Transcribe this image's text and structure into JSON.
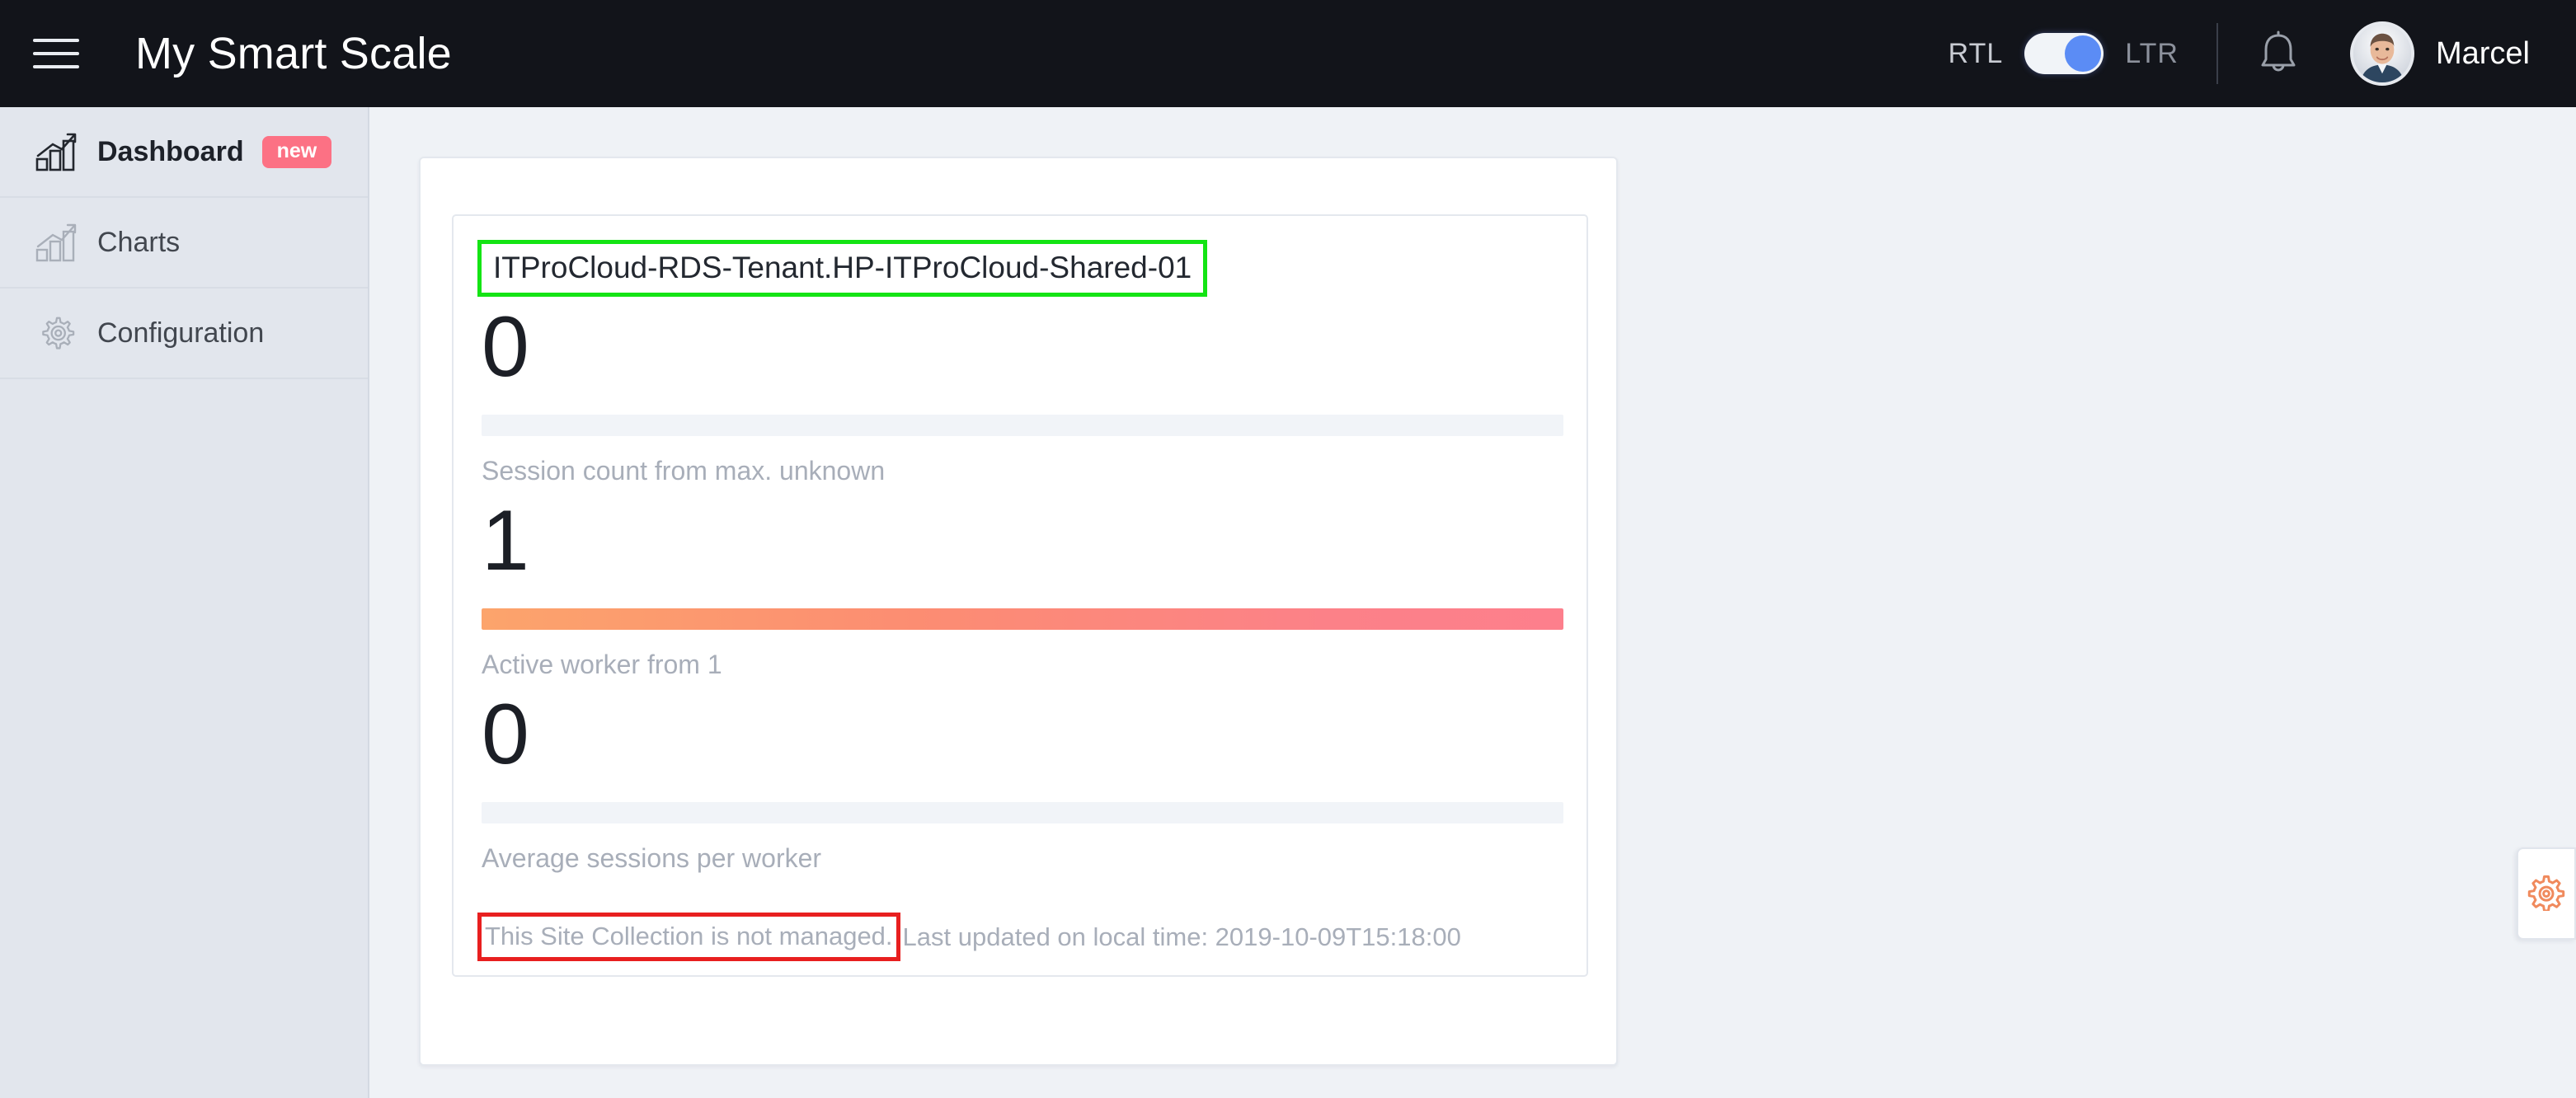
{
  "topbar": {
    "menu_icon": "hamburger-menu-icon",
    "app_title": "My Smart Scale",
    "rtl_label": "RTL",
    "ltr_label": "LTR",
    "direction_toggle_state": "LTR",
    "bell_icon": "notification-bell-icon",
    "user_name": "Marcel",
    "avatar_icon": "user-avatar",
    "accent_toggle_color": "#5b8cf5",
    "background_color": "#12141a"
  },
  "sidebar": {
    "background_color": "#e2e6ed",
    "items": [
      {
        "label": "Dashboard",
        "icon": "bar-chart-growth-icon",
        "badge": "new",
        "active": true
      },
      {
        "label": "Charts",
        "icon": "bar-chart-growth-icon",
        "badge": "",
        "active": false
      },
      {
        "label": "Configuration",
        "icon": "gear-icon",
        "badge": "",
        "active": false
      }
    ],
    "badge_color": "#fc7184"
  },
  "main": {
    "site_title": "ITProCloud-RDS-Tenant.HP-ITProCloud-Shared-01",
    "metrics": [
      {
        "value": "0",
        "label": "Session count from max. unknown",
        "fill_percent": 0,
        "fill_style": "empty"
      },
      {
        "value": "1",
        "label": "Active worker from 1",
        "fill_percent": 100,
        "fill_style": "gradient"
      },
      {
        "value": "0",
        "label": "Average sessions per worker",
        "fill_percent": 0,
        "fill_style": "empty"
      }
    ],
    "footer": {
      "managed_note": "This Site Collection is not managed.",
      "updated_note": "Last updated on local time: 2019-10-09T15:18:00"
    },
    "annotations": {
      "title_box_color": "#14e414",
      "managed_box_color": "#e81f1f"
    },
    "background_color": "#eff2f6"
  },
  "settings_flyout": {
    "icon": "gear-icon",
    "icon_color": "#f08a5d"
  }
}
